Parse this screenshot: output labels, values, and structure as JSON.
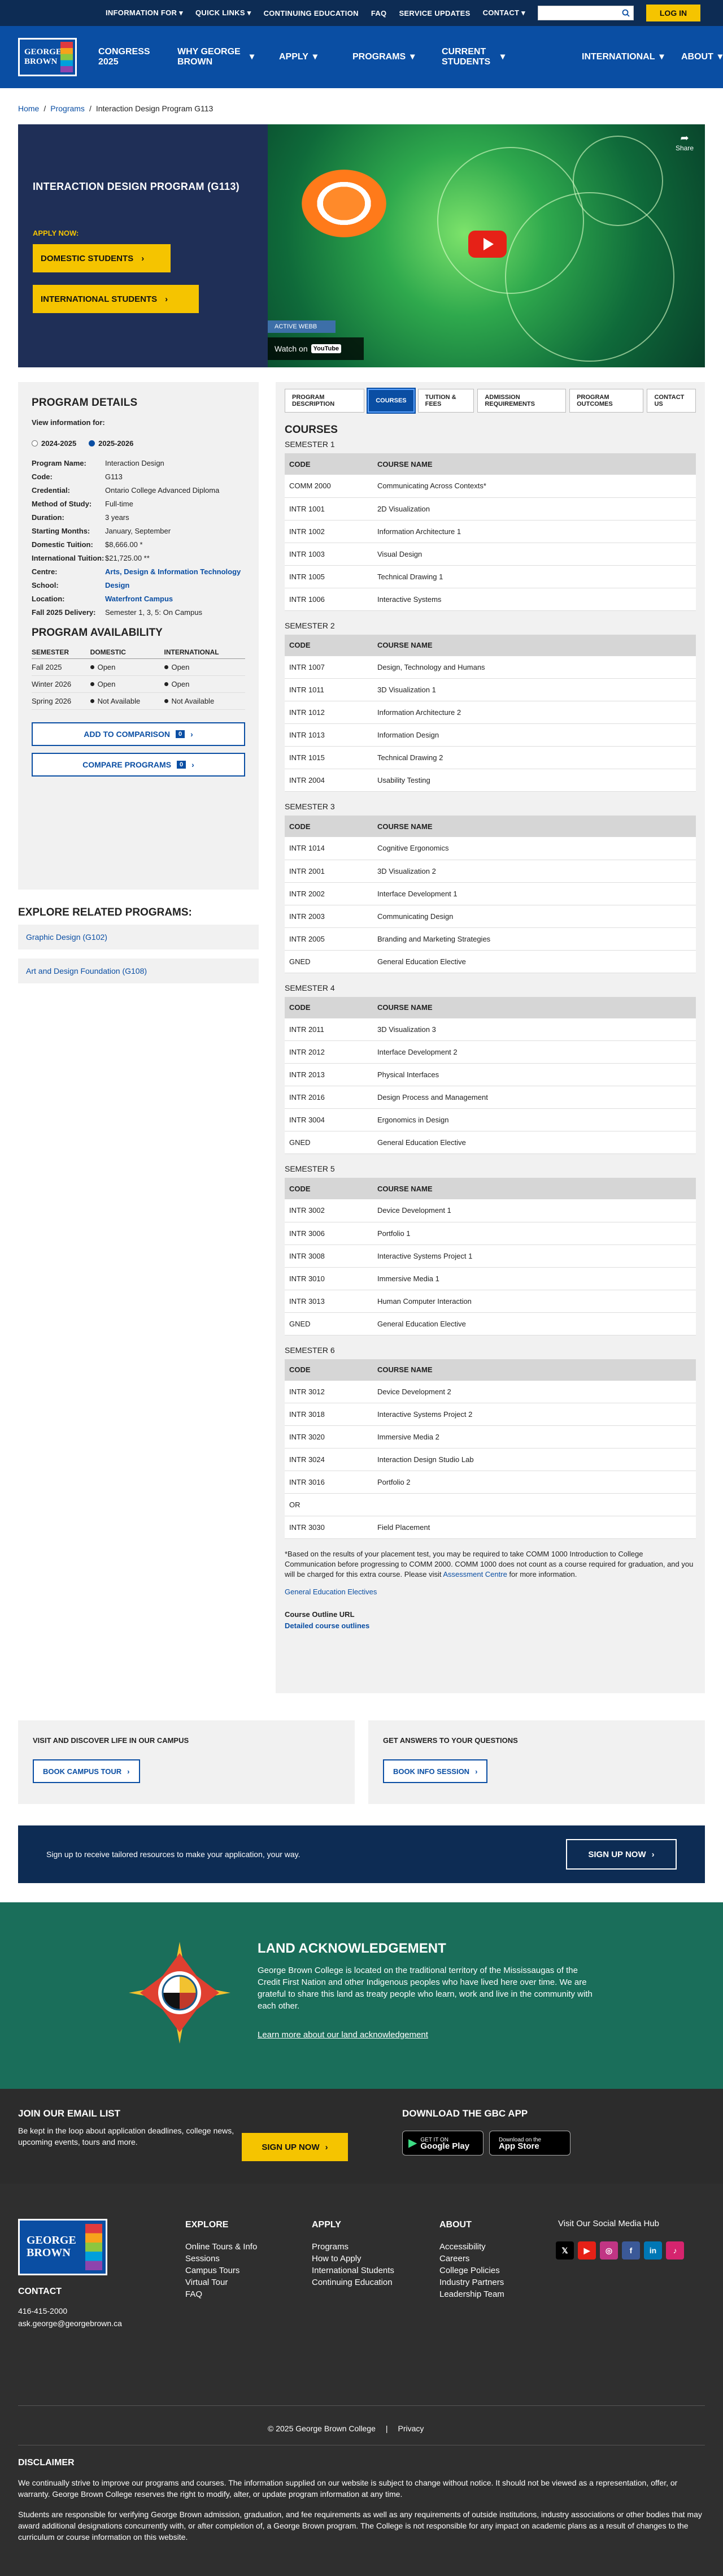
{
  "topbar": {
    "links": [
      "INFORMATION FOR",
      "QUICK LINKS",
      "CONTINUING EDUCATION",
      "FAQ",
      "SERVICE UPDATES",
      "CONTACT"
    ],
    "login": "LOG IN"
  },
  "logo": {
    "line1": "GEORGE",
    "line2": "BROWN"
  },
  "nav": {
    "items": [
      {
        "label": "CONGRESS 2025"
      },
      {
        "label": "WHY GEORGE BROWN"
      },
      {
        "label": "APPLY"
      },
      {
        "label": "PROGRAMS"
      },
      {
        "label": "CURRENT STUDENTS"
      },
      {
        "label": "INTERNATIONAL"
      },
      {
        "label": "ABOUT"
      }
    ]
  },
  "breadcrumb": {
    "home": "Home",
    "programs": "Programs",
    "current": "Interaction Design Program G113"
  },
  "hero": {
    "title": "INTERACTION DESIGN PROGRAM (G113)",
    "apply_label": "APPLY NOW:",
    "domestic_btn": "DOMESTIC STUDENTS",
    "international_btn": "INTERNATIONAL STUDENTS",
    "video": {
      "share": "Share",
      "tag": "ACTIVE WEBB",
      "watch_on": "Watch on",
      "youtube": "YouTube"
    }
  },
  "details": {
    "title": "PROGRAM DETAILS",
    "view_for": "View information for:",
    "years": [
      "2024-2025",
      "2025-2026"
    ],
    "rows": [
      {
        "k": "Program Name:",
        "v": "Interaction Design"
      },
      {
        "k": "Code:",
        "v": "G113"
      },
      {
        "k": "Credential:",
        "v": "Ontario College Advanced Diploma"
      },
      {
        "k": "Method of Study:",
        "v": "Full-time"
      },
      {
        "k": "Duration:",
        "v": "3 years"
      },
      {
        "k": "Starting Months:",
        "v": "January, September"
      },
      {
        "k": "Domestic Tuition:",
        "v": "$8,666.00 *"
      },
      {
        "k": "International Tuition:",
        "v": "$21,725.00 **"
      },
      {
        "k": "Centre:",
        "v": "Arts, Design & Information Technology"
      },
      {
        "k": "School:",
        "v": "Design"
      },
      {
        "k": "Location:",
        "v": "Waterfront Campus"
      },
      {
        "k": "Fall 2025 Delivery:",
        "v": "Semester 1, 3, 5: On Campus"
      }
    ],
    "availability_title": "PROGRAM AVAILABILITY",
    "availability_headers": [
      "SEMESTER",
      "DOMESTIC",
      "INTERNATIONAL"
    ],
    "availability": [
      {
        "sem": "Fall 2025",
        "dom": "Open",
        "intl": "Open"
      },
      {
        "sem": "Winter 2026",
        "dom": "Open",
        "intl": "Open"
      },
      {
        "sem": "Spring 2026",
        "dom": "Not Available",
        "intl": "Not Available"
      }
    ],
    "add_compare": "ADD TO COMPARISON",
    "compare_programs": "COMPARE PROGRAMS",
    "compare_count": "0"
  },
  "explore": {
    "title": "EXPLORE RELATED PROGRAMS:",
    "items": [
      "Graphic Design (G102)",
      "Art and Design Foundation (G108)"
    ]
  },
  "tabs": [
    "PROGRAM DESCRIPTION",
    "COURSES",
    "TUITION & FEES",
    "ADMISSION REQUIREMENTS",
    "PROGRAM OUTCOMES",
    "CONTACT US"
  ],
  "courses": {
    "title": "COURSES",
    "headers": [
      "CODE",
      "COURSE NAME"
    ],
    "semesters": [
      {
        "name": "SEMESTER 1",
        "rows": [
          [
            "COMM 2000",
            "Communicating Across Contexts*"
          ],
          [
            "INTR 1001",
            "2D Visualization"
          ],
          [
            "INTR 1002",
            "Information Architecture 1"
          ],
          [
            "INTR 1003",
            "Visual Design"
          ],
          [
            "INTR 1005",
            "Technical Drawing 1"
          ],
          [
            "INTR 1006",
            "Interactive Systems"
          ]
        ]
      },
      {
        "name": "SEMESTER 2",
        "rows": [
          [
            "INTR 1007",
            "Design, Technology and Humans"
          ],
          [
            "INTR 1011",
            "3D Visualization 1"
          ],
          [
            "INTR 1012",
            "Information Architecture 2"
          ],
          [
            "INTR 1013",
            "Information Design"
          ],
          [
            "INTR 1015",
            "Technical Drawing 2"
          ],
          [
            "INTR 2004",
            "Usability Testing"
          ]
        ]
      },
      {
        "name": "SEMESTER 3",
        "rows": [
          [
            "INTR 1014",
            "Cognitive Ergonomics"
          ],
          [
            "INTR 2001",
            "3D Visualization 2"
          ],
          [
            "INTR 2002",
            "Interface Development 1"
          ],
          [
            "INTR 2003",
            "Communicating Design"
          ],
          [
            "INTR 2005",
            "Branding and Marketing Strategies"
          ],
          [
            "GNED",
            "General Education Elective"
          ]
        ]
      },
      {
        "name": "SEMESTER 4",
        "rows": [
          [
            "INTR 2011",
            "3D Visualization 3"
          ],
          [
            "INTR 2012",
            "Interface Development 2"
          ],
          [
            "INTR 2013",
            "Physical Interfaces"
          ],
          [
            "INTR 2016",
            "Design Process and Management"
          ],
          [
            "INTR 3004",
            "Ergonomics in Design"
          ],
          [
            "GNED",
            "General Education Elective"
          ]
        ]
      },
      {
        "name": "SEMESTER 5",
        "rows": [
          [
            "INTR 3002",
            "Device Development 1"
          ],
          [
            "INTR 3006",
            "Portfolio 1"
          ],
          [
            "INTR 3008",
            "Interactive Systems Project 1"
          ],
          [
            "INTR 3010",
            "Immersive Media 1"
          ],
          [
            "INTR 3013",
            "Human Computer Interaction"
          ],
          [
            "GNED",
            "General Education Elective"
          ]
        ]
      },
      {
        "name": "SEMESTER 6",
        "rows": [
          [
            "INTR 3012",
            "Device Development 2"
          ],
          [
            "INTR 3018",
            "Interactive Systems Project 2"
          ],
          [
            "INTR 3020",
            "Immersive Media 2"
          ],
          [
            "INTR 3024",
            "Interaction Design Studio Lab"
          ],
          [
            "INTR 3016",
            "Portfolio 2"
          ],
          [
            "OR",
            ""
          ],
          [
            "INTR 3030",
            "Field Placement"
          ]
        ]
      }
    ],
    "note": "*Based on the results of your placement test, you may be required to take COMM 1000 Introduction to College Communication before progressing to COMM 2000. COMM 1000 does not count as a course required for graduation, and you will be charged for this extra course. Please visit",
    "note_link": "Assessment Centre",
    "note_end": "for more information.",
    "gen_ed": "General Education Electives",
    "outline_label": "Course Outline URL",
    "outline_link": "Detailed course outlines"
  },
  "band": {
    "visit_title": "VISIT AND DISCOVER LIFE IN OUR CAMPUS",
    "visit_btn": "BOOK CAMPUS TOUR",
    "answers_title": "GET ANSWERS TO YOUR QUESTIONS",
    "answers_btn": "BOOK INFO SESSION"
  },
  "signup": {
    "text": "Sign up to receive tailored resources to make your application, your way.",
    "btn": "SIGN UP NOW"
  },
  "land": {
    "title": "LAND ACKNOWLEDGEMENT",
    "text": "George Brown College is located on the traditional territory of the Mississaugas of the Credit First Nation and other Indigenous peoples who have lived here over time. We are grateful to share this land as treaty people who learn, work and live in the community with each other.",
    "link": "Learn more about our land acknowledgement"
  },
  "email": {
    "title": "JOIN OUR EMAIL LIST",
    "text": "Be kept in the loop about application deadlines, college news, upcoming events, tours and more.",
    "btn": "SIGN UP NOW",
    "app_title": "DOWNLOAD THE GBC APP",
    "google_small": "GET IT ON",
    "google_big": "Google Play",
    "apple_small": "Download on the",
    "apple_big": "App Store"
  },
  "footer": {
    "contact_title": "CONTACT",
    "phone": "416-415-2000",
    "email": "ask.george@georgebrown.ca",
    "cols": [
      {
        "title": "EXPLORE",
        "items": [
          "Online Tours & Info Sessions",
          "Campus Tours",
          "Virtual Tour",
          "FAQ"
        ]
      },
      {
        "title": "APPLY",
        "items": [
          "Programs",
          "How to Apply",
          "International Students",
          "Continuing Education"
        ]
      },
      {
        "title": "ABOUT",
        "items": [
          "Accessibility",
          "Careers",
          "College Policies",
          "Industry Partners",
          "Leadership Team"
        ]
      }
    ],
    "social_title": "Visit Our Social Media Hub",
    "copyright": "© 2025 George Brown College",
    "privacy": "Privacy",
    "disclaimer_title": "DISCLAIMER",
    "disclaimer_1": "We continually strive to improve our programs and courses. The information supplied on our website is subject to change without notice. It should not be viewed as a representation, offer, or warranty. George Brown College reserves the right to modify, alter, or update program information at any time.",
    "disclaimer_2": "Students are responsible for verifying George Brown admission, graduation, and fee requirements as well as any requirements of outside institutions, industry associations or other bodies that may award additional designations concurrently with, or after completion of, a George Brown program. The College is not responsible for any impact on academic plans as a result of changes to the curriculum or course information on this website."
  },
  "colors": {
    "navy": "#0d2c54",
    "blue": "#0a4ea3",
    "yellow": "#f5c400",
    "green": "#1a6e5a"
  }
}
